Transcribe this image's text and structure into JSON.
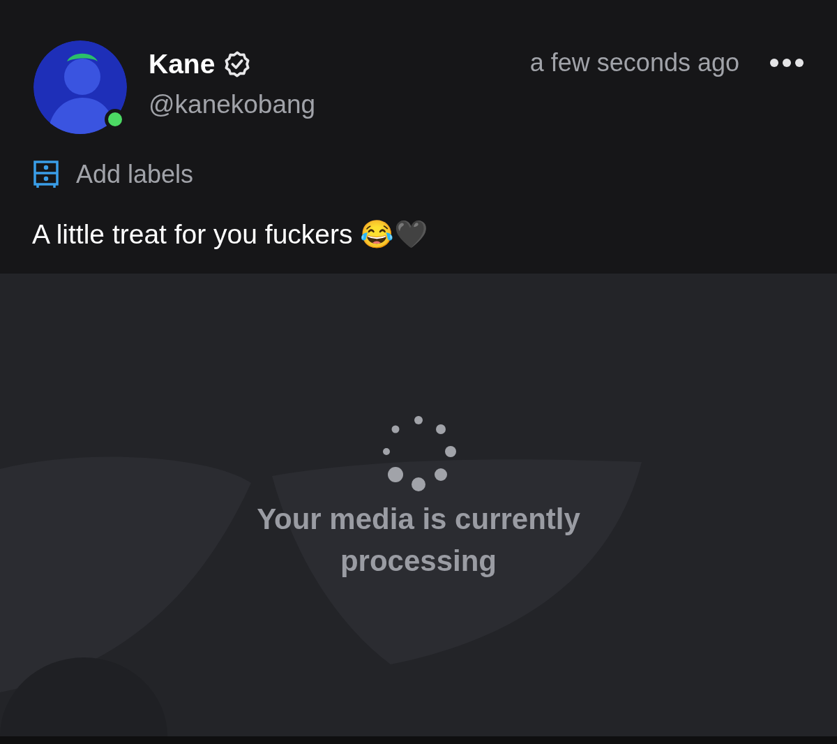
{
  "post": {
    "author": {
      "name": "Kane",
      "verified": true,
      "handle": "@kanekobang",
      "online": true
    },
    "time": "a few seconds ago",
    "labels_action": "Add labels",
    "caption": "A little treat for you fuckers 😂🖤"
  },
  "media": {
    "status": "Your media is currently processing"
  }
}
